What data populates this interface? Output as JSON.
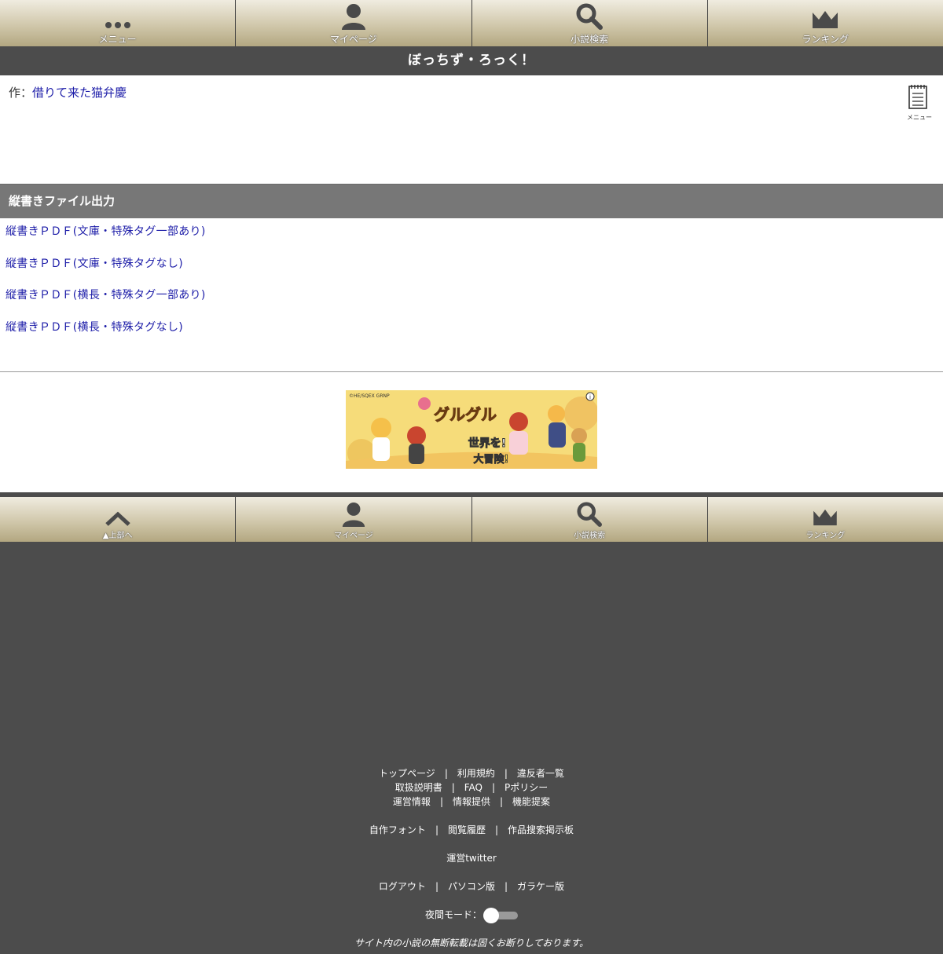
{
  "top_nav": {
    "items": [
      {
        "label": "メニュー",
        "icon": "dots-icon"
      },
      {
        "label": "マイページ",
        "icon": "user-icon"
      },
      {
        "label": "小説検索",
        "icon": "search-icon"
      },
      {
        "label": "ランキング",
        "icon": "crown-icon"
      }
    ]
  },
  "page_title": "ぼっちず・ろっく！",
  "author": {
    "prefix": "作：",
    "name": "借りて来た猫弁慶"
  },
  "menu_icon_label": "メニュー",
  "section": {
    "title": "縦書きファイル出力",
    "links": [
      "縦書きＰＤＦ(文庫・特殊タグ一部あり)",
      "縦書きＰＤＦ(文庫・特殊タグなし)",
      "縦書きＰＤＦ(横長・特殊タグ一部あり)",
      "縦書きＰＤＦ(横長・特殊タグなし)"
    ]
  },
  "ad": {
    "copyright": "©HE/SQEX GRNP",
    "headline": "グルグルの世界を!",
    "subline": "大冒険!"
  },
  "bottom_nav": {
    "items": [
      {
        "label": "▲上部へ",
        "icon": "chevron-up-icon"
      },
      {
        "label": "マイページ",
        "icon": "user-icon"
      },
      {
        "label": "小説検索",
        "icon": "search-icon"
      },
      {
        "label": "ランキング",
        "icon": "crown-icon"
      }
    ]
  },
  "footer": {
    "row1": [
      "トップページ",
      "利用規約",
      "違反者一覧"
    ],
    "row2": [
      "取扱説明書",
      "FAQ",
      "Pポリシー"
    ],
    "row3": [
      "運営情報",
      "情報提供",
      "機能提案"
    ],
    "row4": [
      "自作フォント",
      "閲覧履歴",
      "作品搜索掲示板"
    ],
    "row5": [
      "運営twitter"
    ],
    "row6": [
      "ログアウト",
      "パソコン版",
      "ガラケー版"
    ],
    "night_mode_label": "夜間モード：",
    "night_mode_on": false,
    "notice": "サイト内の小説の無断転載は固くお断りしております。"
  },
  "colors": {
    "nav_gold": "#cdc4a6",
    "dark_bg": "#4c4c4c",
    "section_gray": "#777777",
    "link_blue": "#1c1ca8"
  }
}
